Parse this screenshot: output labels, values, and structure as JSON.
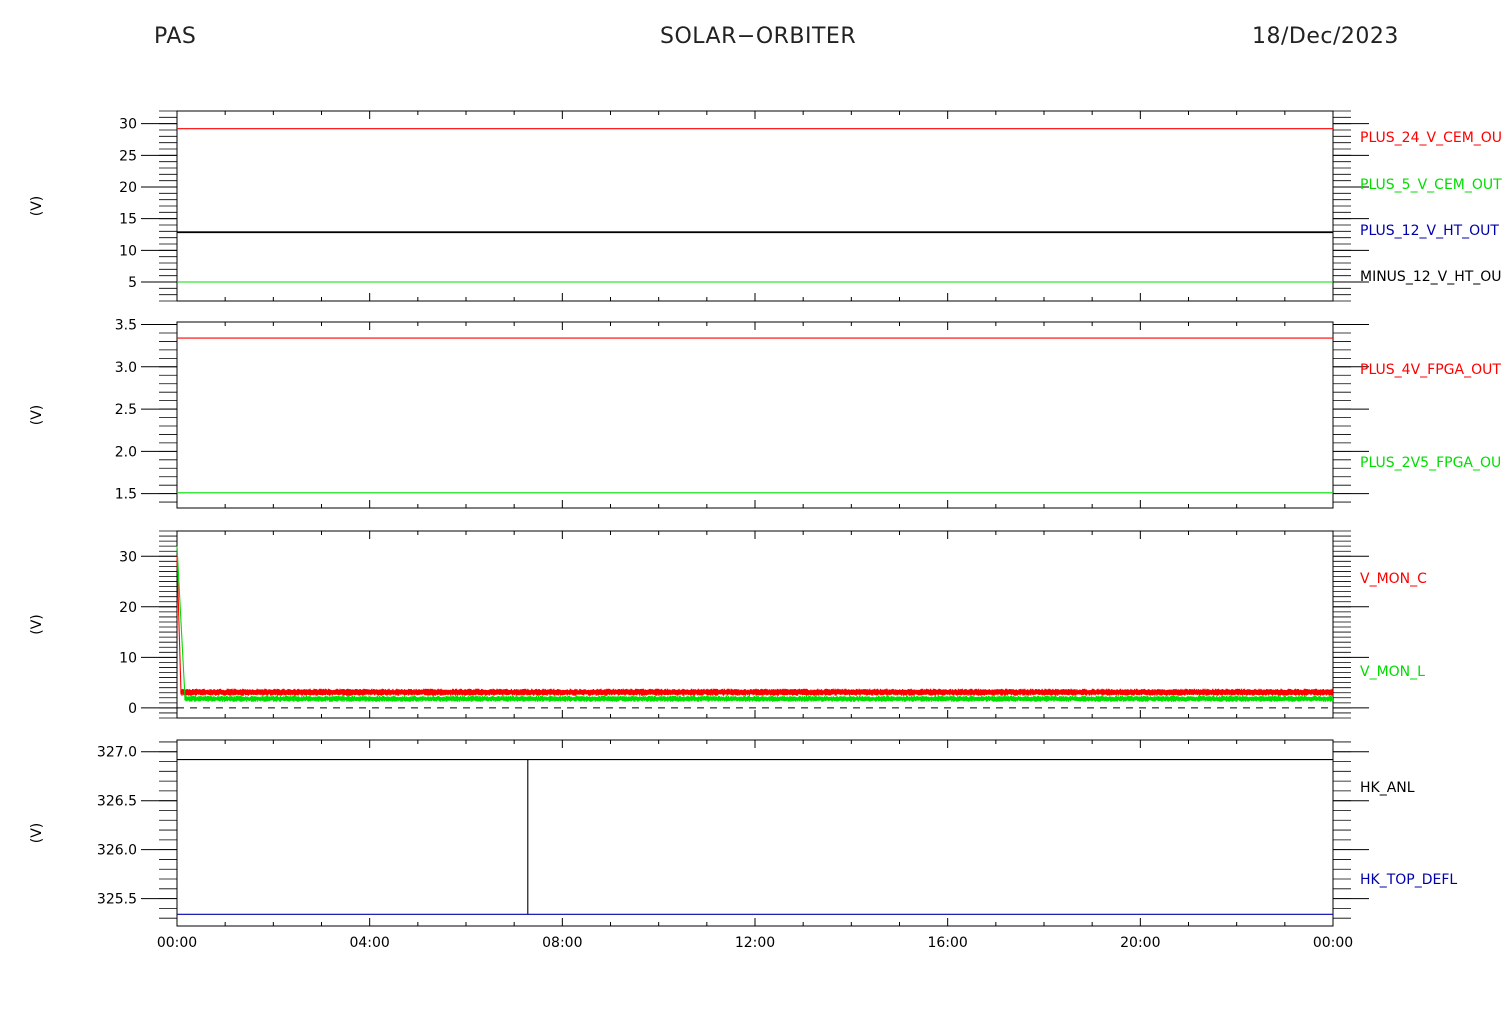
{
  "header": {
    "instrument": "PAS",
    "mission": "SOLAR−ORBITER",
    "date": "18/Dec/2023"
  },
  "colors": {
    "red": "#ff0000",
    "green": "#00dd00",
    "blue": "#0000aa",
    "black": "#000000"
  },
  "chart_data": {
    "type": "line",
    "xlim": [
      "00:00",
      "24:00"
    ],
    "x_tick_labels": [
      "00:00",
      "04:00",
      "08:00",
      "12:00",
      "16:00",
      "20:00",
      "00:00"
    ],
    "panels": [
      {
        "ylabel": "(V)",
        "ylim": [
          2,
          32
        ],
        "y_tick_labels": [
          "5",
          "10",
          "15",
          "20",
          "25",
          "30"
        ],
        "series": [
          {
            "name": "PLUS_24_V_CEM_OUT",
            "label": "PLUS_24_V_CEM_OU",
            "color": "red",
            "points": [
              [
                "00:00",
                29.2
              ],
              [
                "24:00",
                29.2
              ]
            ]
          },
          {
            "name": "PLUS_5_V_CEM_OUT",
            "label": "PLUS_5_V_CEM_OUT",
            "color": "green",
            "points": [
              [
                "00:00",
                5.0
              ],
              [
                "24:00",
                5.0
              ]
            ]
          },
          {
            "name": "PLUS_12_V_HT_OUT",
            "label": "PLUS_12_V_HT_OUT",
            "color": "blue",
            "points": [
              [
                "00:00",
                12.9
              ],
              [
                "24:00",
                12.9
              ]
            ]
          },
          {
            "name": "MINUS_12_V_HT_OUT",
            "label": "MINUS_12_V_HT_OU",
            "color": "black",
            "points": [
              [
                "00:00",
                12.8
              ],
              [
                "24:00",
                12.8
              ]
            ]
          }
        ]
      },
      {
        "ylabel": "(V)",
        "ylim": [
          1.33,
          3.53
        ],
        "y_tick_labels": [
          "1.5",
          "2.0",
          "2.5",
          "3.0",
          "3.5"
        ],
        "series": [
          {
            "name": "PLUS_4V_FPGA_OUT",
            "label": "PLUS_4V_FPGA_OUT",
            "color": "red",
            "points": [
              [
                "00:00",
                3.34
              ],
              [
                "24:00",
                3.34
              ]
            ]
          },
          {
            "name": "PLUS_2V5_FPGA_OUT",
            "label": "PLUS_2V5_FPGA_OU",
            "color": "green",
            "points": [
              [
                "00:00",
                1.51
              ],
              [
                "24:00",
                1.51
              ]
            ]
          }
        ]
      },
      {
        "ylabel": "(V)",
        "ylim": [
          -2,
          35
        ],
        "y_tick_labels": [
          "0",
          "10",
          "20",
          "30"
        ],
        "series": [
          {
            "name": "V_MON_C",
            "label": "V_MON_C",
            "color": "red",
            "noise": [
              2.4,
              3.8
            ],
            "points": [
              [
                "00:00",
                30
              ],
              [
                "00:05",
                3
              ]
            ]
          },
          {
            "name": "V_MON_L",
            "label": "V_MON_L",
            "color": "green",
            "noise": [
              1.2,
              2.4
            ],
            "points": [
              [
                "00:00",
                32
              ],
              [
                "00:10",
                2
              ]
            ]
          }
        ],
        "dashed_level": 0
      },
      {
        "ylabel": "(V)",
        "ylim": [
          325.22,
          327.12
        ],
        "y_tick_labels": [
          "325.5",
          "326.0",
          "326.5",
          "327.0"
        ],
        "series": [
          {
            "name": "HK_ANL",
            "label": "HK_ANL",
            "color": "black",
            "points": [
              [
                "00:00",
                326.92
              ],
              [
                "07:17",
                326.92
              ],
              [
                "07:17",
                325.34
              ],
              [
                "07:17",
                326.92
              ],
              [
                "24:00",
                326.92
              ]
            ]
          },
          {
            "name": "HK_TOP_DEFL",
            "label": "HK_TOP_DEFL",
            "color": "blue",
            "points": [
              [
                "00:00",
                325.34
              ],
              [
                "24:00",
                325.34
              ]
            ]
          }
        ]
      }
    ]
  }
}
